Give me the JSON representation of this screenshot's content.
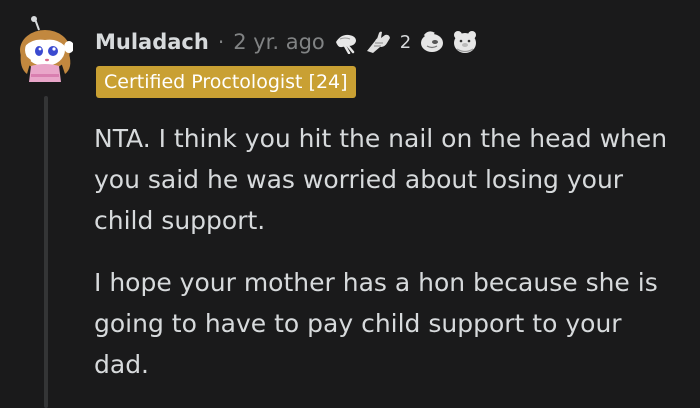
{
  "comment": {
    "username": "Muladach",
    "separator": "·",
    "time": "2 yr. ago",
    "awards": [
      {
        "icon": "hand-wave-award-icon"
      },
      {
        "icon": "arm-wrestle-award-icon",
        "count": "2"
      },
      {
        "icon": "white-blob-award-icon"
      },
      {
        "icon": "bear-hug-award-icon"
      }
    ],
    "flair": "Certified Proctologist [24]",
    "flair_color": "#c9a033",
    "paragraphs": [
      "NTA. I think you hit the nail on the head when you said he was worried about losing your child support.",
      "I hope your mother has a hon because she is going to have to pay child support to your dad."
    ]
  },
  "colors": {
    "background": "#1a1a1b",
    "text": "#d7dadc",
    "muted": "#818384",
    "thread_line": "#343536"
  }
}
